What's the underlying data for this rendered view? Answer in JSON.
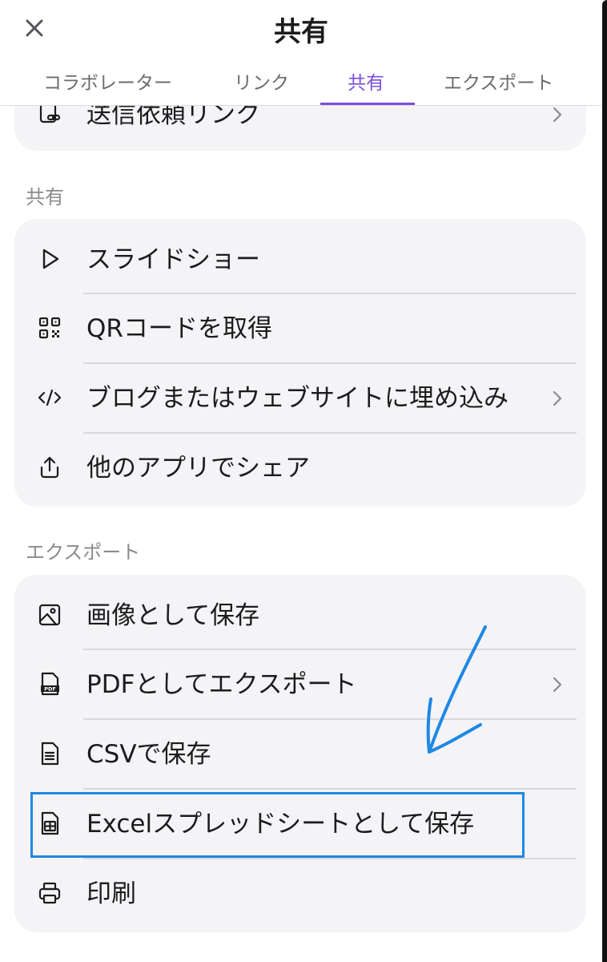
{
  "header": {
    "title": "共有",
    "close_label": "×",
    "tabs": [
      {
        "label": "コラボレーター",
        "active": false
      },
      {
        "label": "リンク",
        "active": false
      },
      {
        "label": "共有",
        "active": true
      },
      {
        "label": "エクスポート",
        "active": false
      }
    ]
  },
  "top_card": {
    "item": {
      "label": "送信依頼リンク",
      "icon": "link-doc-icon",
      "has_chevron": true
    }
  },
  "share_section": {
    "title": "共有",
    "items": [
      {
        "label": "スライドショー",
        "icon": "play-icon",
        "has_chevron": false
      },
      {
        "label": "QRコードを取得",
        "icon": "qr-code-icon",
        "has_chevron": false
      },
      {
        "label": "ブログまたはウェブサイトに埋め込み",
        "icon": "code-icon",
        "has_chevron": true
      },
      {
        "label": "他のアプリでシェア",
        "icon": "share-icon",
        "has_chevron": false
      }
    ]
  },
  "export_section": {
    "title": "エクスポート",
    "items": [
      {
        "label": "画像として保存",
        "icon": "image-icon",
        "has_chevron": false
      },
      {
        "label": "PDFとしてエクスポート",
        "icon": "pdf-icon",
        "has_chevron": true
      },
      {
        "label": "CSVで保存",
        "icon": "document-icon",
        "has_chevron": false
      },
      {
        "label": "Excelスプレッドシートとして保存",
        "icon": "spreadsheet-icon",
        "has_chevron": false
      },
      {
        "label": "印刷",
        "icon": "printer-icon",
        "has_chevron": false
      }
    ]
  },
  "annotation": {
    "highlight_color": "#1e88e5",
    "highlighted_item": "Excelスプレッドシートとして保存"
  },
  "colors": {
    "accent": "#7b4fd6",
    "card_bg": "#f4f4f6",
    "section_text": "#8a8a8e"
  }
}
